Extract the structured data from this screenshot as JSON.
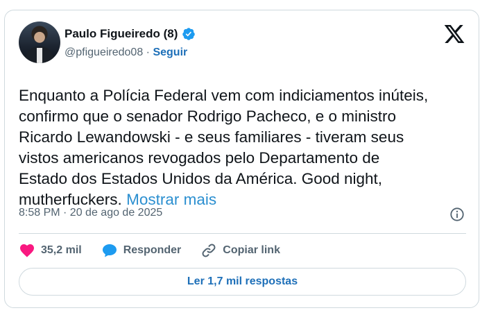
{
  "author": {
    "name": "Paulo Figueiredo (8)",
    "handle": "@pfigueiredo08",
    "separator": "·",
    "follow_label": "Seguir"
  },
  "tweet": {
    "text": "Enquanto a Polícia Federal vem com indiciamentos inúteis,\nconfirmo que o senador Rodrigo Pacheco, e o ministro\nRicardo Lewandowski - e seus familiares - tiveram seus\nvistos americanos revogados pelo Departamento de\nEstado dos Estados Unidos da América. Good night,\nmutherfuckers.",
    "show_more": "Mostrar mais",
    "timestamp": "8:58 PM · 20 de ago de 2025"
  },
  "actions": {
    "likes": "35,2 mil",
    "reply_label": "Responder",
    "copy_link_label": "Copiar link"
  },
  "replies_button": "Ler 1,7 mil respostas",
  "icons": {
    "verified": "verified-badge-icon",
    "platform": "x-logo-icon",
    "info": "info-icon",
    "like": "heart-icon",
    "reply": "reply-bubble-icon",
    "copy": "link-icon"
  },
  "colors": {
    "like": "#f91880",
    "reply": "#1d9bf0",
    "link": "#1d6fb8",
    "verified": "#1d9bf0"
  }
}
